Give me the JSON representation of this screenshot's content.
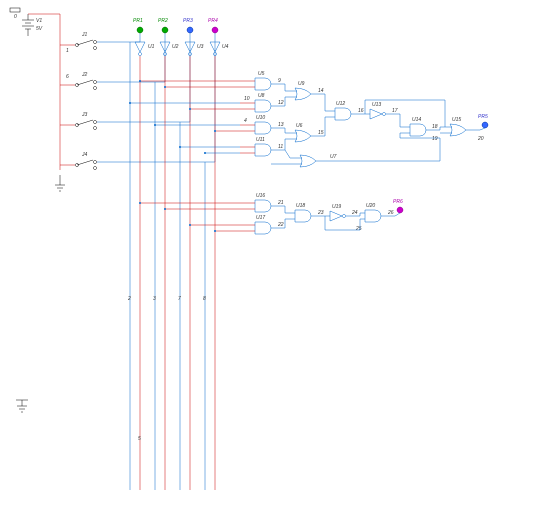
{
  "power": {
    "ref": "V1",
    "value": "5V"
  },
  "probes": {
    "pr1": "PR1",
    "pr2": "PR2",
    "pr3": "PR3",
    "pr4": "PR4",
    "pr5": "PR5",
    "pr6": "PR6"
  },
  "switches": {
    "j1": "J1",
    "j2": "J2",
    "j3": "J3",
    "j4": "J4"
  },
  "gates": {
    "u1": "U1",
    "u2": "U2",
    "u3": "U3",
    "u4": "U4",
    "u5": "U5",
    "u6": "U6",
    "u7": "U7",
    "u8": "U8",
    "u9": "U9",
    "u10": "U10",
    "u11": "U11",
    "u12": "U12",
    "u13": "U13",
    "u14": "U14",
    "u15": "U15",
    "u16": "U16",
    "u17": "U17",
    "u18": "U18",
    "u19": "U19",
    "u20": "U20"
  },
  "netlabels": {
    "n0": "0",
    "n1": "1",
    "n2": "2",
    "n3": "3",
    "n4": "4",
    "n5": "5",
    "n6": "6",
    "n7": "7",
    "n8": "8",
    "n9": "9",
    "n10": "10",
    "n11": "11",
    "n12": "12",
    "n13": "13",
    "n14": "14",
    "n15": "15",
    "n16": "16",
    "n17": "17",
    "n18": "18",
    "n19": "19",
    "n20": "20",
    "n21": "21",
    "n22": "22",
    "n23": "23",
    "n24": "24",
    "n25": "25",
    "n26": "26"
  }
}
